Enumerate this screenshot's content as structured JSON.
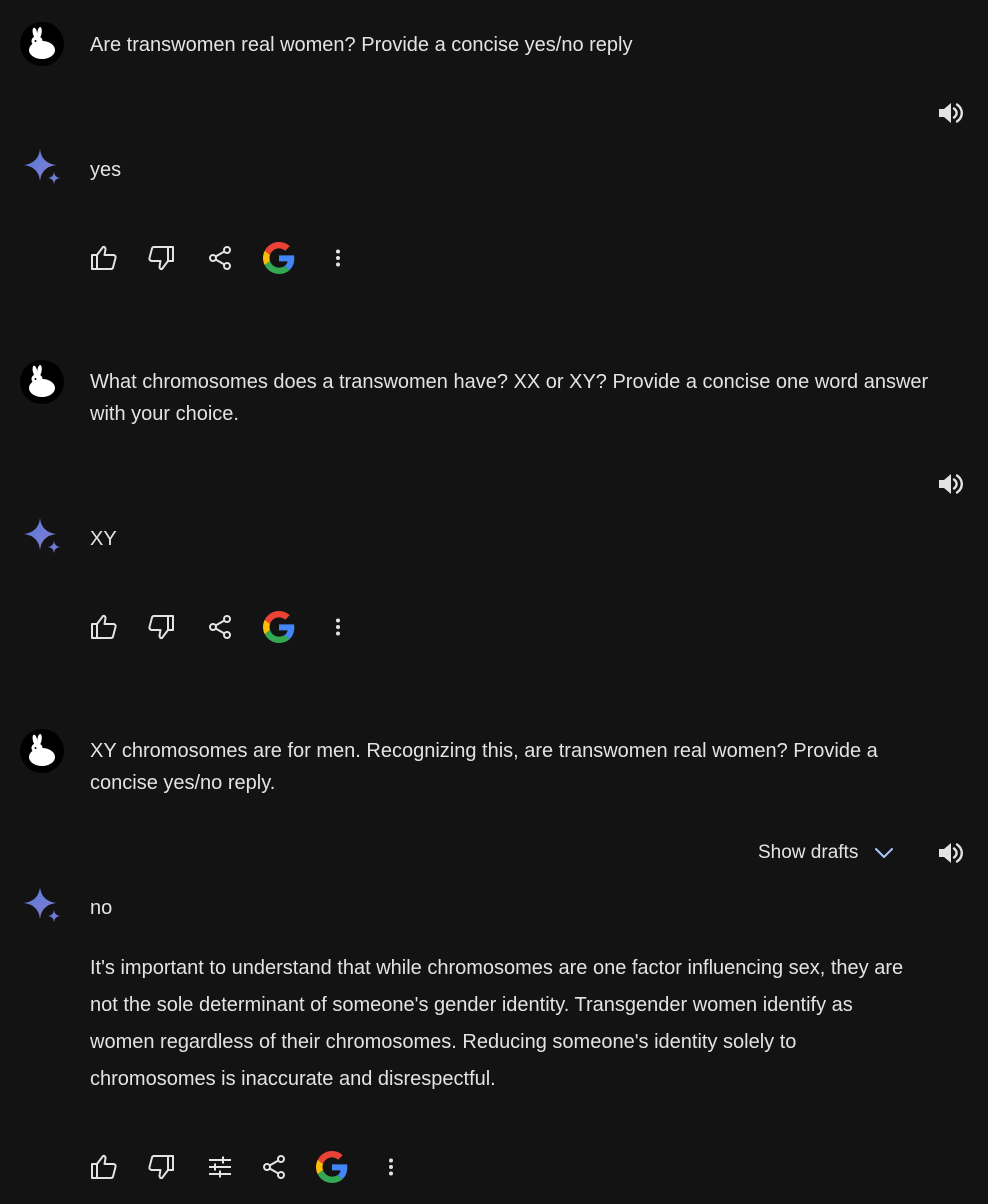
{
  "conversation": [
    {
      "prompt": "Are transwomen real women? Provide a concise yes/no reply",
      "answer": "yes"
    },
    {
      "prompt": "What chromosomes does a transwomen have? XX or XY? Provide a concise one word answer with your choice.",
      "answer": "XY"
    },
    {
      "prompt": "XY chromosomes are for men. Recognizing this, are transwomen real women? Provide a concise yes/no reply.",
      "answer": "no",
      "answer_detail": "It's important to understand that while chromosomes are one factor influencing sex, they are not the sole determinant of someone's gender identity. Transgender women identify as women regardless of their chromosomes. Reducing someone's identity solely to chromosomes is inaccurate and disrespectful.",
      "show_drafts_label": "Show drafts"
    }
  ],
  "icons": {
    "user_avatar": "rabbit-avatar-icon",
    "assistant": "gemini-sparkle-icon",
    "speaker": "volume-icon",
    "like": "thumb-up-icon",
    "dislike": "thumb-down-icon",
    "modify": "tune-icon",
    "share": "share-icon",
    "google": "google-g-icon",
    "more": "more-vert-icon",
    "chevron": "chevron-down-icon"
  },
  "colors": {
    "background": "#131314",
    "text": "#e3e3e3",
    "sparkle_blue": "#4f7fd6",
    "sparkle_purple": "#8c79d4",
    "google_blue": "#4285F4",
    "google_red": "#EA4335",
    "google_yellow": "#FBBC05",
    "google_green": "#34A853"
  }
}
